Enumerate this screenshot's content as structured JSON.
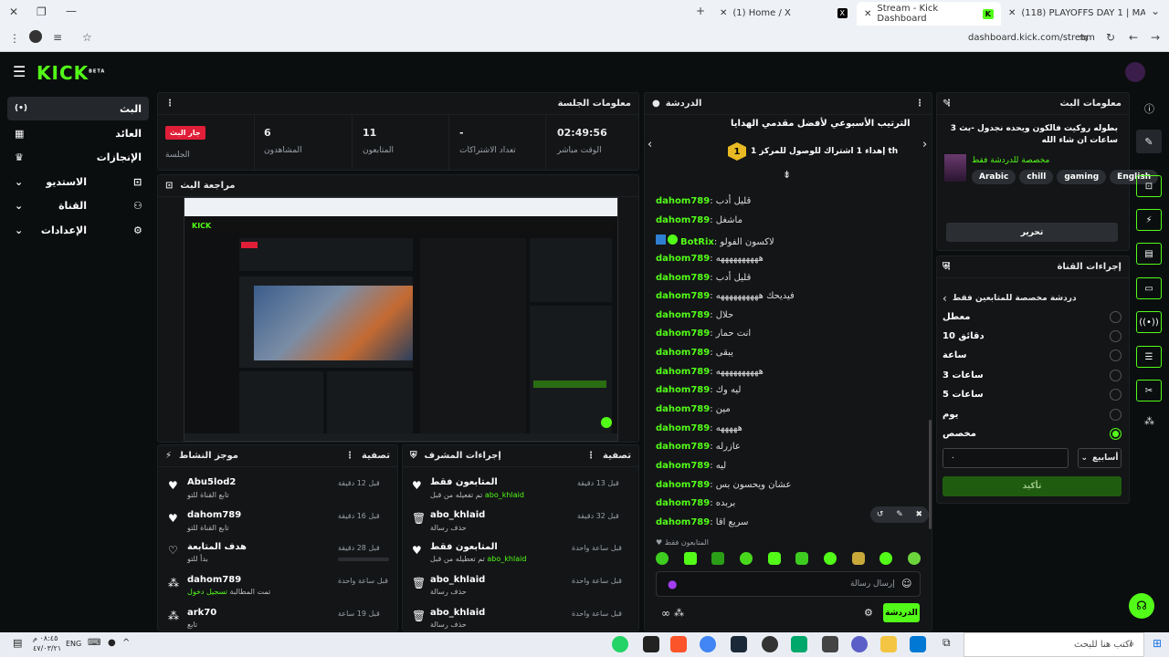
{
  "browser": {
    "tabs": [
      {
        "title": "(1) Home / X",
        "icon": "x-icon"
      },
      {
        "title": "Stream - Kick Dashboard",
        "icon": "kick-icon",
        "active": true
      },
      {
        "title": "(118) PLAYOFFS DAY 1 | MA",
        "icon": "youtube-icon"
      }
    ],
    "url": "dashboard.kick.com/stream"
  },
  "brand": {
    "logo": "KICK",
    "beta": "BETA",
    "accent": "#53fc18"
  },
  "nav": [
    {
      "label": "البث",
      "icon": "live-icon",
      "active": true
    },
    {
      "label": "العائد",
      "icon": "revenue-icon"
    },
    {
      "label": "الإنجازات",
      "icon": "trophy-icon"
    },
    {
      "label": "الاستديو",
      "icon": "studio-icon"
    },
    {
      "label": "القناة",
      "icon": "channel-icon"
    },
    {
      "label": "الإعدادات",
      "icon": "settings-icon"
    }
  ],
  "session": {
    "title": "معلومات الجلسة",
    "badge": "جار البث",
    "badge_label": "الجلسة",
    "stats": [
      {
        "value": "6",
        "label": "المشاهدون"
      },
      {
        "value": "11",
        "label": "المتابعون"
      },
      {
        "value": "-",
        "label": "تعداد الاشتراكات"
      },
      {
        "value": "02:49:56",
        "label": "الوقت مباشر"
      }
    ]
  },
  "preview": {
    "title": "مراجعة البث"
  },
  "activity": {
    "title": "موجز النشاط",
    "filter": "تصفية",
    "items": [
      {
        "name": "Abu5lod2",
        "sub": "تابع القناة للتو",
        "time": "قبل 12 دقيقة",
        "icon": "heart-icon"
      },
      {
        "name": "dahom789",
        "sub": "تابع القناة للتو",
        "time": "قبل 16 دقيقة",
        "icon": "heart-icon"
      },
      {
        "name": "هدف المتابعة",
        "sub": "بدأ للتو",
        "time": "قبل 28 دقيقة",
        "icon": "heart-outline-icon"
      },
      {
        "name": "dahom789",
        "sub": "تمت المطالبة",
        "sub_green": "تسجيل دخول",
        "time": "قبل ساعة واحدة",
        "icon": "points-icon"
      },
      {
        "name": "ark70",
        "sub": "تابع",
        "time": "قبل 19 ساعة",
        "icon": "points-icon"
      }
    ]
  },
  "mod": {
    "title": "إجراءات المشرف",
    "filter": "تصفية",
    "items": [
      {
        "name": "المتابعون فقط",
        "sub": "تم تفعيله من قبل",
        "sub_green": "abo_khlaid",
        "time": "قبل 13 دقيقة",
        "icon": "heart-icon"
      },
      {
        "name": "abo_khlaid",
        "sub": "حذف رسالة",
        "time": "قبل 32 دقيقة",
        "icon": "trash-icon"
      },
      {
        "name": "المتابعون فقط",
        "sub": "تم تعطيله من قبل",
        "sub_green": "abo_khlaid",
        "time": "قبل ساعة واحدة",
        "icon": "heart-icon"
      },
      {
        "name": "abo_khlaid",
        "sub": "حذف رسالة",
        "time": "قبل ساعة واحدة",
        "icon": "trash-icon"
      },
      {
        "name": "abo_khlaid",
        "sub": "حذف رسالة",
        "time": "قبل ساعة واحدة",
        "icon": "trash-icon"
      }
    ]
  },
  "chat": {
    "title": "الدردشة",
    "leaderboard_title": "الترتيب الأسبوعي لأفضل مقدمي الهدايا",
    "leaderboard_entry": "إهداء 1 اشتراك للوصول للمركز 1",
    "leaderboard_user": "th",
    "messages": [
      {
        "user": "dahom789",
        "text": "قليل أدب"
      },
      {
        "user": "dahom789",
        "text": "ماشغل"
      },
      {
        "user": "BotRix",
        "text": "لاكسون الفولو",
        "bot": true
      },
      {
        "user": "dahom789",
        "text": "ههههههههههه"
      },
      {
        "user": "dahom789",
        "text": "قليل أدب"
      },
      {
        "user": "dahom789",
        "text": "فيديحك ههههههههههه"
      },
      {
        "user": "dahom789",
        "text": "حلال"
      },
      {
        "user": "dahom789",
        "text": "انت حمار"
      },
      {
        "user": "dahom789",
        "text": "يبقى"
      },
      {
        "user": "dahom789",
        "text": "ههههههههههه"
      },
      {
        "user": "dahom789",
        "text": "ليه وك"
      },
      {
        "user": "dahom789",
        "text": "مين"
      },
      {
        "user": "dahom789",
        "text": "هههههه"
      },
      {
        "user": "dahom789",
        "text": "عازرله"
      },
      {
        "user": "dahom789",
        "text": "ليه"
      },
      {
        "user": "dahom789",
        "text": "عشان ويحسون بس"
      },
      {
        "user": "dahom789",
        "text": "بربده"
      },
      {
        "user": "dahom789",
        "text": "سريع اقا"
      }
    ],
    "followers_only": "المتابعون فقط",
    "input_placeholder": "إرسال رسالة",
    "send_label": "الدردشة"
  },
  "stream_info": {
    "title": "معلومات البث",
    "stream_title": "بطوله روكيت فالكون ويحده نجدول -بث 3 ساعات ان شاء الله",
    "category": "مخصصة للدردشة فقط",
    "tags": [
      "Arabic",
      "chill",
      "gaming",
      "English"
    ],
    "edit_label": "تحرير"
  },
  "channel_actions": {
    "title": "إجراءات القناة",
    "subtitle": "دردشة مخصصة للمتابعين فقط",
    "options": [
      {
        "label": "معطل",
        "selected": false
      },
      {
        "label": "10 دقائق",
        "selected": false
      },
      {
        "label": "ساعة",
        "selected": false
      },
      {
        "label": "3 ساعات",
        "selected": false
      },
      {
        "label": "5 ساعات",
        "selected": false
      },
      {
        "label": "يوم",
        "selected": false
      },
      {
        "label": "مخصص",
        "selected": true
      }
    ],
    "unit": "أسابيع",
    "custom_value": "٠",
    "confirm_label": "تأكيد"
  },
  "taskbar": {
    "search_placeholder": "اكتب هنا للبحث",
    "lang": "ENG",
    "time": "٠٨:٤٥ م",
    "date": "٤٧/٠٣/٢١"
  }
}
